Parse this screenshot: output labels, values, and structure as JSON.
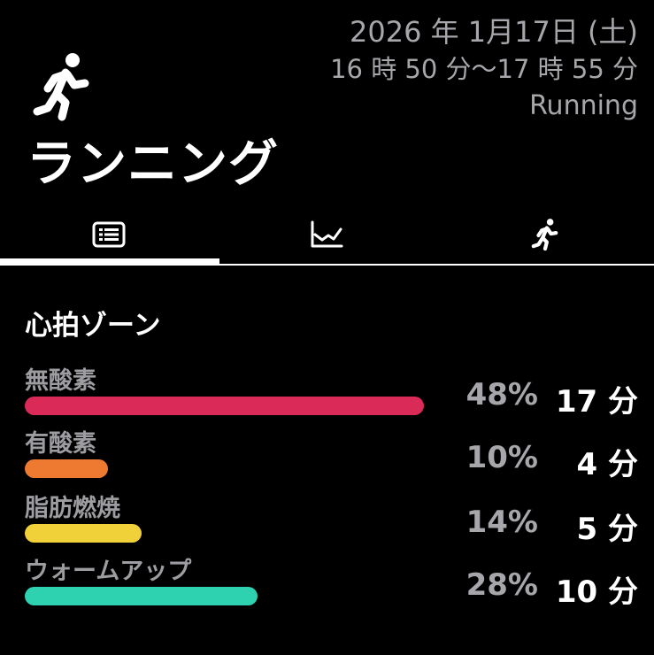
{
  "header": {
    "title": "ランニング",
    "date": "2026 年 1月17日 (土)",
    "time_range": "16 時 50 分〜17 時 55 分",
    "activity_type": "Running",
    "icon": "running-person-icon"
  },
  "tabs": [
    {
      "icon": "summary-list-icon",
      "active": true
    },
    {
      "icon": "line-chart-icon",
      "active": false
    },
    {
      "icon": "running-person-icon",
      "active": false
    }
  ],
  "heart_rate": {
    "title": "心拍ゾーン",
    "zones": [
      {
        "label": "無酸素",
        "percent": "48%",
        "minutes": "17 分",
        "fraction": 0.48,
        "color": "#d92a58"
      },
      {
        "label": "有酸素",
        "percent": "10%",
        "minutes": "4 分",
        "fraction": 0.1,
        "color": "#ee7a32"
      },
      {
        "label": "脂肪燃焼",
        "percent": "14%",
        "minutes": "5 分",
        "fraction": 0.14,
        "color": "#f1d139"
      },
      {
        "label": "ウォームアップ",
        "percent": "28%",
        "minutes": "10 分",
        "fraction": 0.28,
        "color": "#2ed2b0"
      }
    ]
  }
}
